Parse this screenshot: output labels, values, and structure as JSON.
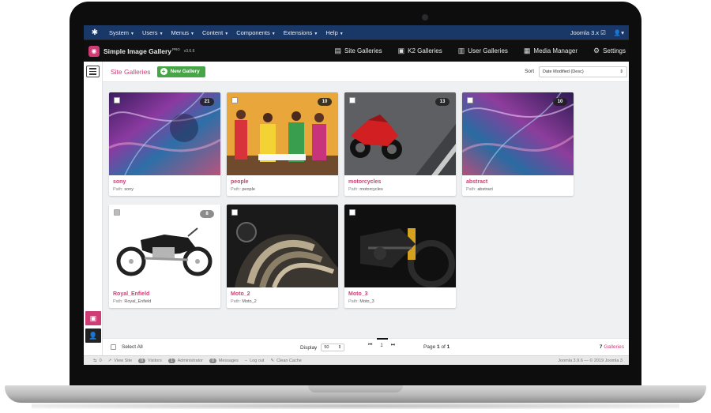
{
  "nav": {
    "items": [
      {
        "label": "System"
      },
      {
        "label": "Users"
      },
      {
        "label": "Menus"
      },
      {
        "label": "Content"
      },
      {
        "label": "Components"
      },
      {
        "label": "Extensions"
      },
      {
        "label": "Help"
      }
    ],
    "site_link": "Joomla 3.x ☑",
    "user_icon": "user-icon"
  },
  "toolbar": {
    "app_title": "Simple Image Gallery",
    "app_edition": "PRO",
    "app_version": "v3.6.6",
    "links": [
      {
        "label": "Site Galleries",
        "icon": "site-galleries-icon"
      },
      {
        "label": "K2 Galleries",
        "icon": "k2-galleries-icon"
      },
      {
        "label": "User Galleries",
        "icon": "user-galleries-icon"
      },
      {
        "label": "Media Manager",
        "icon": "media-manager-icon"
      },
      {
        "label": "Settings",
        "icon": "gear-icon"
      }
    ]
  },
  "header": {
    "title": "Site Galleries",
    "new_button": "New Gallery",
    "sort_label": "Sort",
    "sort_value": "Date Modified (Desc)"
  },
  "galleries": [
    {
      "name": "sony",
      "path_label": "Path:",
      "path": "sony",
      "count": "21"
    },
    {
      "name": "people",
      "path_label": "Path:",
      "path": "people",
      "count": "10"
    },
    {
      "name": "motorcycles",
      "path_label": "Path:",
      "path": "motorcycles",
      "count": "13"
    },
    {
      "name": "abstract",
      "path_label": "Path:",
      "path": "abstract",
      "count": "10"
    },
    {
      "name": "Royal_Enfield",
      "path_label": "Path:",
      "path": "Royal_Enfield",
      "count": "8"
    },
    {
      "name": "Moto_2",
      "path_label": "Path:",
      "path": "Moto_2",
      "count": ""
    },
    {
      "name": "Moto_3",
      "path_label": "Path:",
      "path": "Moto_3",
      "count": ""
    }
  ],
  "footer": {
    "select_all": "Select All",
    "display_label": "Display",
    "display_value": "50",
    "first": "⏮",
    "page_current": "1",
    "last": "⏭",
    "page_word": "Page",
    "page_num": "1",
    "of_word": "of",
    "page_total": "1",
    "total_count": "7",
    "total_label": "Galleries"
  },
  "statusbar": {
    "items": [
      {
        "label": "0",
        "icon": "toggle-icon"
      },
      {
        "label": "View Site",
        "icon": "external-icon"
      },
      {
        "label": "Visitors",
        "badge": "0"
      },
      {
        "label": "Administrator",
        "badge": "1"
      },
      {
        "label": "Messages",
        "badge": "0"
      },
      {
        "label": "Log out",
        "icon": "minus-icon"
      },
      {
        "label": "Clean Cache",
        "icon": "broom-icon"
      }
    ],
    "right": "Joomla 3.9.6 — © 2019 Joomla 3"
  },
  "colors": {
    "accent": "#d03c75",
    "nav_bg": "#1a3867",
    "toolbar_bg": "#0f0f0f",
    "new_button_bg": "#46a546"
  }
}
